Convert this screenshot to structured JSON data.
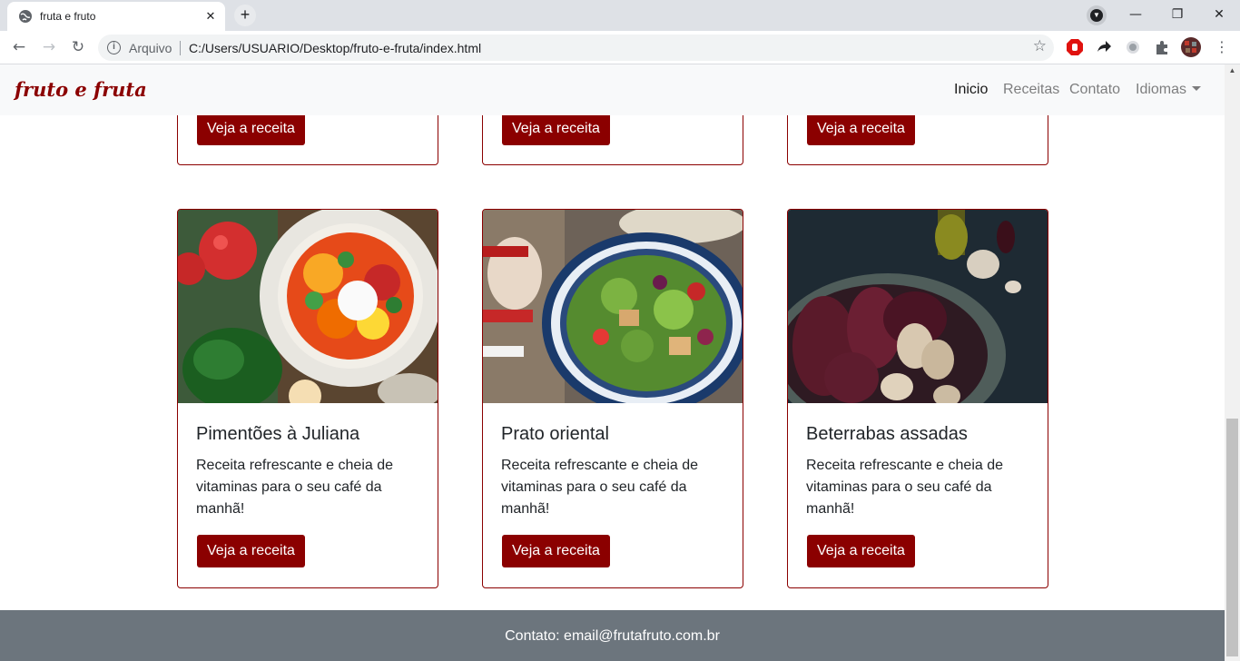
{
  "browser": {
    "tab_title": "fruta e fruto",
    "scheme_label": "Arquivo",
    "url": "C:/Users/USUARIO/Desktop/fruto-e-fruta/index.html"
  },
  "site": {
    "brand": "fruto e fruta",
    "nav": [
      {
        "label": "Inicio"
      },
      {
        "label": "Receitas"
      },
      {
        "label": "Contato"
      },
      {
        "label": "Idiomas"
      }
    ],
    "accent_color": "#8b0000"
  },
  "top_row_cards": [
    {
      "button": "Veja a receita"
    },
    {
      "button": "Veja a receita"
    },
    {
      "button": "Veja a receita"
    }
  ],
  "cards": [
    {
      "title": "Pimentões à Juliana",
      "text": "Receita refrescante e cheia de vitaminas para o seu café da manhã!",
      "button": "Veja a receita",
      "image": "salad-peppers-photo"
    },
    {
      "title": "Prato oriental",
      "text": "Receita refrescante e cheia de vitaminas para o seu café da manhã!",
      "button": "Veja a receita",
      "image": "oriental-salad-bowl-photo"
    },
    {
      "title": "Beterrabas assadas",
      "text": "Receita refrescante e cheia de vitaminas para o seu café da manhã!",
      "button": "Veja a receita",
      "image": "roasted-beets-photo"
    }
  ],
  "footer": {
    "text": "Contato: email@frutafruto.com.br"
  }
}
